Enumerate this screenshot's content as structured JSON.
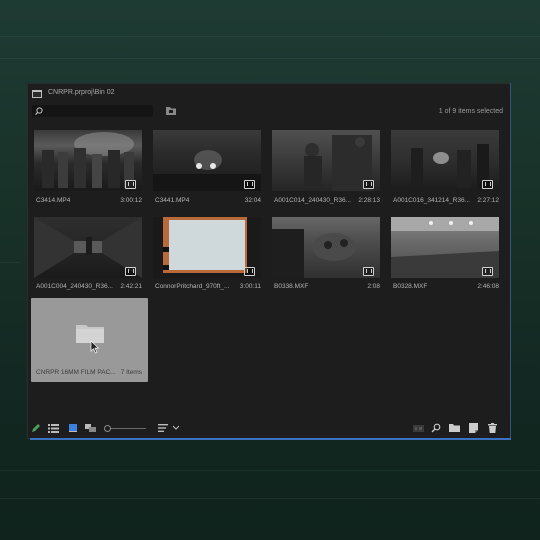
{
  "panel": {
    "title": "CNRPR.prproj\\Bin 02",
    "selection_count": "1 of 9 items selected",
    "search": {
      "value": "",
      "placeholder": ""
    }
  },
  "clips": [
    {
      "name": "C3414.MP4",
      "duration": "3:00:12"
    },
    {
      "name": "C3441.MP4",
      "duration": "32:04"
    },
    {
      "name": "A001C014_240430_R36...",
      "duration": "2:28:13"
    },
    {
      "name": "A001C016_341214_R36...",
      "duration": "2:27:12"
    },
    {
      "name": "A001C004_240430_R36...",
      "duration": "2:42:21"
    },
    {
      "name": "ConnorPritchard_970ft_...",
      "duration": "3:00:11"
    },
    {
      "name": "B0338.MXF",
      "duration": "2:08"
    },
    {
      "name": "B0328.MXF",
      "duration": "2:46:08"
    }
  ],
  "bin": {
    "name": "CNRPR 16MM FILM PAC...",
    "count": "7 Items"
  },
  "colors": {
    "accent": "#3b6fc2",
    "panel_bg": "#1d1d1d",
    "selected_tile": "#999999"
  },
  "icons": [
    "panel-menu-icon",
    "search-icon",
    "new-bin-icon",
    "pen-icon",
    "list-view-icon",
    "icon-view-icon",
    "freeform-view-icon",
    "sort-icon",
    "chevron-down-icon",
    "automate-icon",
    "find-icon",
    "new-bin-icon",
    "new-item-icon",
    "clear-icon"
  ]
}
